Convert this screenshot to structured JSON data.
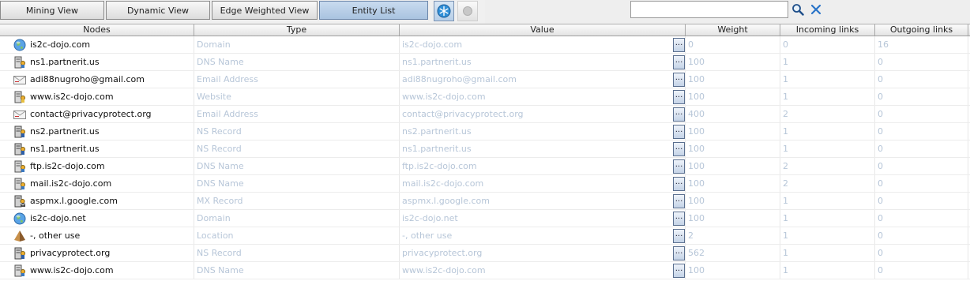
{
  "tabs": [
    {
      "label": "Mining View",
      "active": false
    },
    {
      "label": "Dynamic View",
      "active": false
    },
    {
      "label": "Edge Weighted View",
      "active": false
    },
    {
      "label": "Entity List",
      "active": true
    }
  ],
  "toolbar": {
    "freeze_icon": "snowflake-icon",
    "record_icon": "circle-icon"
  },
  "search": {
    "value": "",
    "placeholder": "",
    "search_icon": "magnifier-icon",
    "clear_icon": "close-x-icon"
  },
  "colors": {
    "active_tab": "#a9c3e0",
    "faded_text": "#b7c6d8",
    "node_text": "#111111"
  },
  "columns": [
    "Nodes",
    "Type",
    "Value",
    "Weight",
    "Incoming links",
    "Outgoing links"
  ],
  "rows": [
    {
      "node": "is2c-dojo.com",
      "icon": "globe-icon",
      "type": "Domain",
      "value": "is2c-dojo.com",
      "weight": "0",
      "incoming": "0",
      "outgoing": "16"
    },
    {
      "node": "ns1.partnerit.us",
      "icon": "dns-server-icon",
      "type": "DNS Name",
      "value": "ns1.partnerit.us",
      "weight": "100",
      "incoming": "1",
      "outgoing": "0"
    },
    {
      "node": "adi88nugroho@gmail.com",
      "icon": "email-icon",
      "type": "Email Address",
      "value": "adi88nugroho@gmail.com",
      "weight": "100",
      "incoming": "1",
      "outgoing": "0"
    },
    {
      "node": "www.is2c-dojo.com",
      "icon": "website-icon",
      "type": "Website",
      "value": "www.is2c-dojo.com",
      "weight": "100",
      "incoming": "1",
      "outgoing": "0"
    },
    {
      "node": "contact@privacyprotect.org",
      "icon": "email-icon",
      "type": "Email Address",
      "value": "contact@privacyprotect.org",
      "weight": "400",
      "incoming": "2",
      "outgoing": "0"
    },
    {
      "node": "ns2.partnerit.us",
      "icon": "ns-record-icon",
      "type": "NS Record",
      "value": "ns2.partnerit.us",
      "weight": "100",
      "incoming": "1",
      "outgoing": "0"
    },
    {
      "node": "ns1.partnerit.us",
      "icon": "ns-record-icon",
      "type": "NS Record",
      "value": "ns1.partnerit.us",
      "weight": "100",
      "incoming": "1",
      "outgoing": "0"
    },
    {
      "node": "ftp.is2c-dojo.com",
      "icon": "dns-server-icon",
      "type": "DNS Name",
      "value": "ftp.is2c-dojo.com",
      "weight": "100",
      "incoming": "2",
      "outgoing": "0"
    },
    {
      "node": "mail.is2c-dojo.com",
      "icon": "dns-server-icon",
      "type": "DNS Name",
      "value": "mail.is2c-dojo.com",
      "weight": "100",
      "incoming": "2",
      "outgoing": "0"
    },
    {
      "node": "aspmx.l.google.com",
      "icon": "mx-record-icon",
      "type": "MX Record",
      "value": "aspmx.l.google.com",
      "weight": "100",
      "incoming": "1",
      "outgoing": "0"
    },
    {
      "node": "is2c-dojo.net",
      "icon": "globe-icon",
      "type": "Domain",
      "value": "is2c-dojo.net",
      "weight": "100",
      "incoming": "1",
      "outgoing": "0"
    },
    {
      "node": "-, other use",
      "icon": "location-pyramid-icon",
      "type": "Location",
      "value": "-, other use",
      "weight": "2",
      "incoming": "1",
      "outgoing": "0"
    },
    {
      "node": "privacyprotect.org",
      "icon": "ns-record-icon",
      "type": "NS Record",
      "value": "privacyprotect.org",
      "weight": "562",
      "incoming": "1",
      "outgoing": "0"
    },
    {
      "node": "www.is2c-dojo.com",
      "icon": "dns-server-icon",
      "type": "DNS Name",
      "value": "www.is2c-dojo.com",
      "weight": "100",
      "incoming": "1",
      "outgoing": "0"
    }
  ],
  "row_button_label": "..."
}
